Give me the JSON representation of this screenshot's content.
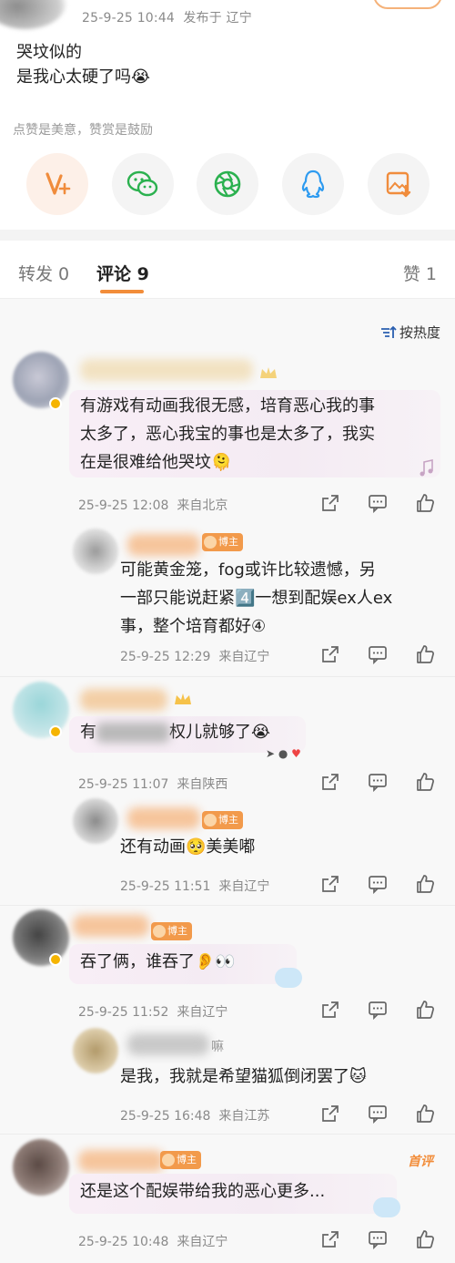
{
  "post": {
    "time": "25-9-25 10:44",
    "location": "发布于 辽宁",
    "body_line1": "哭坟似的",
    "body_line2": "是我心太硬了吗😭",
    "reward_hint": "点赞是美意，赞赏是鼓励"
  },
  "share_icons": [
    "v-plus-icon",
    "wechat-icon",
    "moments-icon",
    "qq-icon",
    "save-image-icon"
  ],
  "tabs": {
    "repost": "转发 0",
    "comment": "评论 9",
    "like": "赞 1"
  },
  "sort_label": "按热度",
  "host_badge": "博主",
  "top_tag": "首评",
  "colors": {
    "accent": "#f28d3a",
    "host_badge": "#f29a4b",
    "vip": "#f5b400",
    "bubble": "#f6edf5"
  },
  "comments": [
    {
      "text_line1": "有游戏有动画我很无感，培育恶心我的事",
      "text_line2": "太多了，恶心我宝的事也是太多了，我实",
      "text_line3": "在是很难给他哭坟🫠",
      "time": "25-9-25 12:08",
      "location": "来自北京"
    },
    {
      "text_line1": "可能黄金笼，fog或许比较遗憾，另",
      "text_line2": "一部只能说赶紧4️⃣一想到配娱ex人ex",
      "text_line3": "事，整个培育都好④",
      "time": "25-9-25 12:29",
      "location": "来自辽宁"
    },
    {
      "text_pre": "有",
      "text_post": "权儿就够了😭",
      "time": "25-9-25 11:07",
      "location": "来自陕西"
    },
    {
      "text": "还有动画🥺美美嘟",
      "time": "25-9-25 11:51",
      "location": "来自辽宁"
    },
    {
      "text": "吞了俩，谁吞了👂👀",
      "time": "25-9-25 11:52",
      "location": "来自辽宁"
    },
    {
      "name_fragment": "嘛",
      "text": "是我，我就是希望猫狐倒闭罢了🐱",
      "time": "25-9-25 16:48",
      "location": "来自江苏"
    },
    {
      "text": "还是这个配娱带给我的恶心更多...",
      "time": "25-9-25 10:48",
      "location": "来自辽宁"
    }
  ]
}
